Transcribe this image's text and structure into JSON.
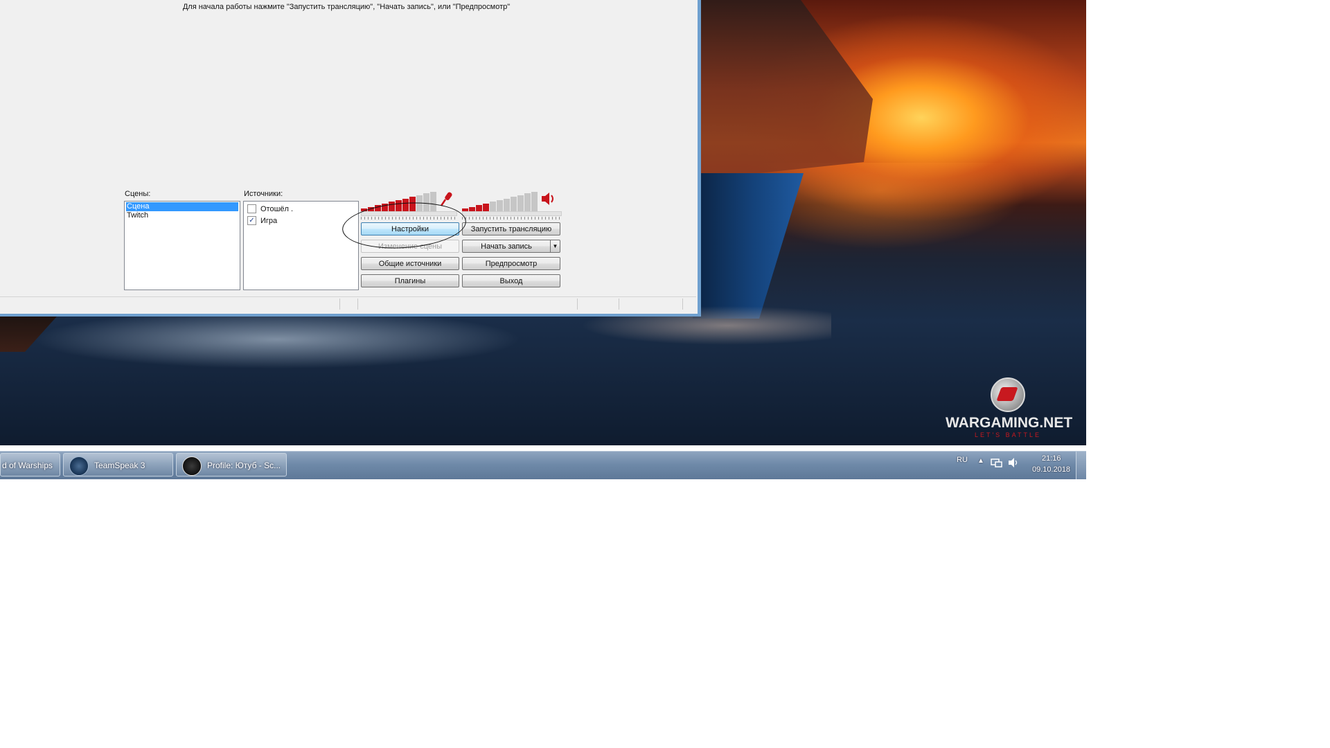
{
  "window": {
    "hint": "Для начала работы нажмите \"Запустить трансляцию\", \"Начать запись\", или \"Предпросмотр\"",
    "scenes_label": "Сцены:",
    "sources_label": "Источники:",
    "scenes": [
      "Сцена",
      "Twitch"
    ],
    "sources": [
      {
        "label": "Отошёл .",
        "checked": false
      },
      {
        "label": "Игра",
        "checked": true
      }
    ],
    "buttons": {
      "settings": "Настройки",
      "start_stream": "Запустить трансляцию",
      "edit_scene": "Изменение сцены",
      "start_record": "Начать запись",
      "global_sources": "Общие источники",
      "preview": "Предпросмотр",
      "plugins": "Плагины",
      "exit": "Выход"
    },
    "mic_meter": {
      "level": 0.75,
      "icon": "microphone-icon"
    },
    "desktop_meter": {
      "level": 0.4,
      "icon": "speaker-icon"
    },
    "accent_color": "#c8141c"
  },
  "wallpaper": {
    "brand": "WARGAMING.NET",
    "tagline": "LET'S BATTLE"
  },
  "taskbar": {
    "items": [
      {
        "label": "d of Warships"
      },
      {
        "label": "TeamSpeak 3",
        "icon": "teamspeak-icon"
      },
      {
        "label": "Profile: Ютуб - Sc...",
        "icon": "obs-icon"
      }
    ],
    "language": "RU",
    "time": "21:16",
    "date": "09.10.2018"
  }
}
